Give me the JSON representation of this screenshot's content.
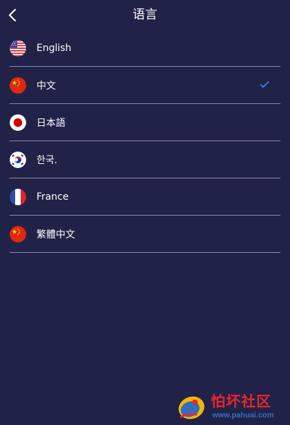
{
  "header": {
    "title": "语言",
    "back_icon": "chevron-left-icon"
  },
  "languages": [
    {
      "label": "English",
      "flag": "us-flag-icon",
      "selected": false
    },
    {
      "label": "中文",
      "flag": "china-flag-icon",
      "selected": true
    },
    {
      "label": "日本語",
      "flag": "japan-flag-icon",
      "selected": false
    },
    {
      "label": "한국.",
      "flag": "korea-flag-icon",
      "selected": false
    },
    {
      "label": "France",
      "flag": "france-flag-icon",
      "selected": false
    },
    {
      "label": "繁體中文",
      "flag": "china-flag-icon",
      "selected": false
    }
  ],
  "colors": {
    "background": "#212248",
    "divider": "#8d8ea9",
    "check": "#3b82f6"
  },
  "watermark": {
    "title": "怕坏社区",
    "url": "www.pahuai.com"
  }
}
